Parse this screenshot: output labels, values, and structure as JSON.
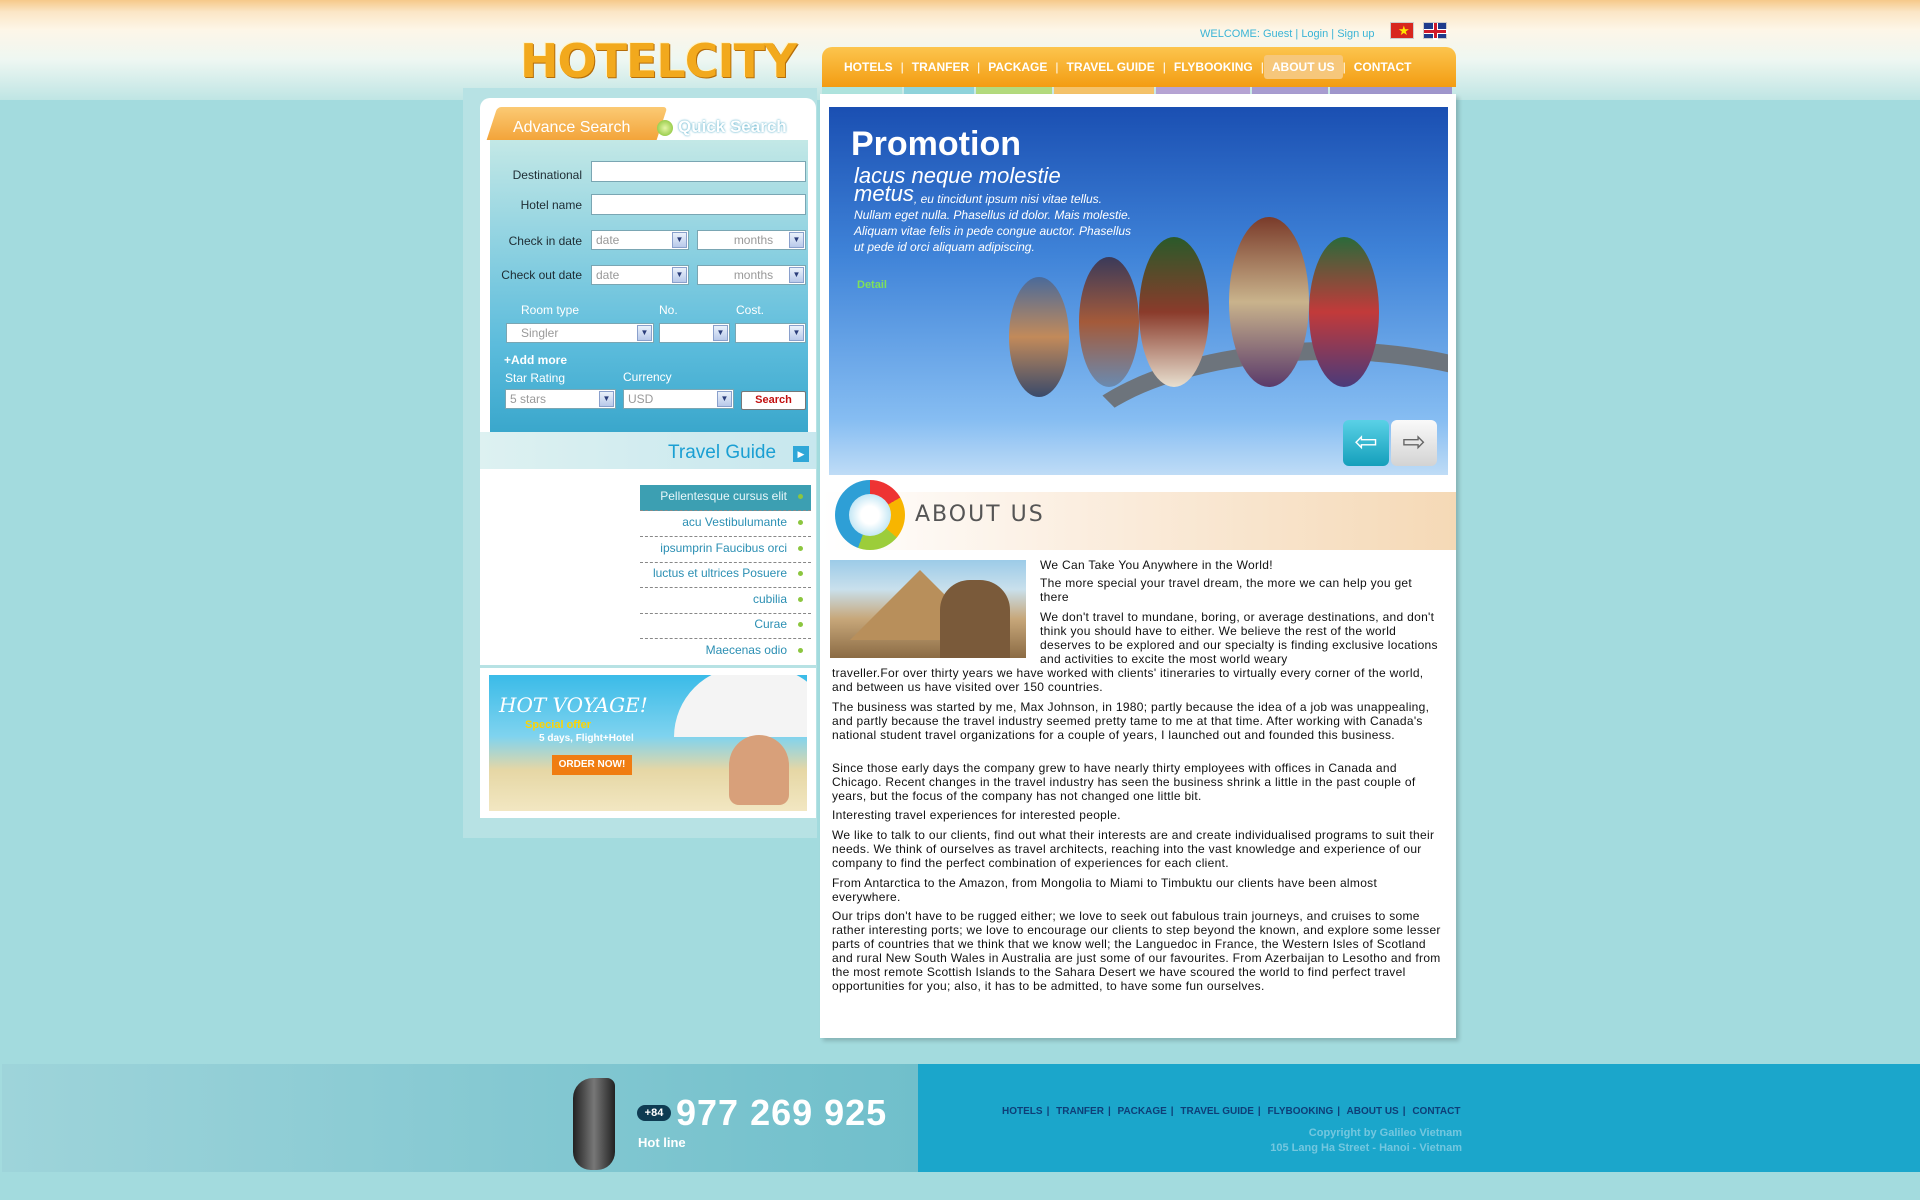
{
  "header": {
    "logo_text": "HOTELCITY",
    "welcome_prefix": "WELCOME:",
    "guest": "Guest",
    "login": "Login",
    "signup": "Sign up",
    "divider": "|",
    "flags": [
      "vietnam-flag-icon",
      "uk-flag-icon"
    ]
  },
  "nav": {
    "items": [
      "HOTELS",
      "TRANFER",
      "PACKAGE",
      "TRAVEL GUIDE",
      "FLYBOOKING",
      "ABOUT US",
      "CONTACT"
    ],
    "active": "ABOUT US",
    "stripe_colors": [
      "#aee3dd",
      "#8fd3db",
      "#b3da7d",
      "#f4c26a",
      "#b6a3d3",
      "#a89cd0",
      "#9f96cc"
    ]
  },
  "search": {
    "tab_advance": "Advance Search",
    "tab_quick": "Quick Search",
    "destination_label": "Destinational",
    "hotel_label": "Hotel name",
    "checkin_label": "Check in date",
    "checkout_label": "Check out date",
    "date_placeholder": "date",
    "months_placeholder": "months",
    "room_type_label": "Room type",
    "no_label": "No.",
    "cost_label": "Cost.",
    "room_type_value": "Singler",
    "add_more": "+Add more",
    "star_label": "Star Rating",
    "currency_label": "Currency",
    "star_value": "5 stars",
    "currency_value": "USD",
    "search_button": "Search"
  },
  "travel_guide": {
    "title": "Travel Guide",
    "items": [
      "Pellentesque cursus elit",
      "acu Vestibulumante",
      "ipsumprin Faucibus orci",
      "luctus et ultrices Posuere",
      "cubilia",
      "Curae",
      "Maecenas odio"
    ]
  },
  "banner": {
    "title": "HOT VOYAGE!",
    "offer": "Special offer",
    "days": "5 days, Flight+Hotel",
    "order": "ORDER NOW!"
  },
  "promotion": {
    "title": "Promotion",
    "heading": "lacus neque molestie metus",
    "text": ", eu tincidunt ipsum nisi vitae tellus. Nullam eget nulla. Phasellus id dolor. Mais molestie. Aliquam vitae felis in pede congue auctor. Phasellus ut pede id orci aliquam adipiscing.",
    "detail": "Detail"
  },
  "about": {
    "title": "ABOUT US",
    "p1": "We Can Take You Anywhere in the World!",
    "p2": "The more special your travel dream, the more we can help you get there",
    "p3a": "We don't travel to mundane, boring, or average destinations, and don't think you should have to either. We believe the rest of the world deserves to be explored and our specialty is finding exclusive locations and activities to excite the most world weary",
    "p3b": "traveller.For over thirty years we have worked with clients' itineraries to virtually every corner of the world, and between us have visited over 150 countries.",
    "p4": "The business was started by me, Max Johnson, in 1980; partly because the idea of a job was unappealing, and partly because the travel industry seemed pretty tame to me at that time. After working with Canada's national student travel organizations for a couple of years, I launched out and founded this business.",
    "p5": "Since those early days the company grew to have nearly thirty employees with offices in Canada and Chicago. Recent changes in the travel industry has seen the business shrink a little in the past couple of years, but the focus of the company has not changed one little bit.",
    "p6": "Interesting travel experiences for interested people.",
    "p7": "We like to talk to our clients, find out what their interests are and create individualised programs to suit their needs. We think of ourselves as travel architects, reaching into the vast knowledge and experience of our company to find the perfect combination of experiences for each client.",
    "p8": "From Antarctica to the Amazon, from Mongolia to Miami to Timbuktu our clients have been almost everywhere.",
    "p9": "Our trips don't have to be rugged either; we love to seek out fabulous train journeys, and cruises to some rather interesting ports; we love to encourage our clients to step beyond the known, and explore some lesser parts of countries that we think that we know well; the Languedoc in France, the Western Isles of Scotland and rural New South Wales in Australia are just some of our favourites. From Azerbaijan to Lesotho and from the most remote Scottish Islands to the Sahara Desert we have scoured the world to find perfect travel opportunities for you; also, it has to be admitted, to have some fun ourselves."
  },
  "footer": {
    "country_code": "+84",
    "hotline_number": "977 269 925",
    "hotline_label": "Hot line",
    "nav": [
      "HOTELS",
      "TRANFER",
      "PACKAGE",
      "TRAVEL GUIDE",
      "FLYBOOKING",
      "ABOUT US",
      "CONTACT"
    ],
    "copyright": "Copyright by Galileo Vietnam",
    "address": "105 Lang Ha Street - Hanoi - Vietnam"
  }
}
